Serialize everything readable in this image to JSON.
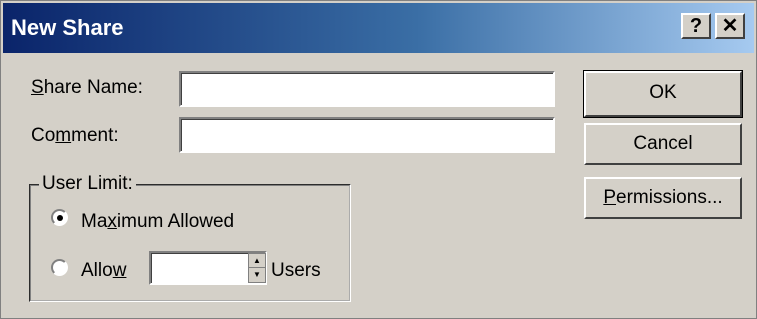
{
  "window": {
    "title": "New Share",
    "help_label": "?",
    "close_label": "✕"
  },
  "form": {
    "share_name_label_prefix": "",
    "share_name_label_accel": "S",
    "share_name_label_rest": "hare Name:",
    "share_name_value": "",
    "comment_label_pre": "Co",
    "comment_label_accel": "m",
    "comment_label_rest": "ment:",
    "comment_value": ""
  },
  "user_limit": {
    "legend": "User Limit:",
    "maximum_label_pre": "Ma",
    "maximum_label_accel": "x",
    "maximum_label_rest": "imum Allowed",
    "maximum_selected": true,
    "allow_label_pre": "Allo",
    "allow_label_accel": "w",
    "allow_label_rest": "",
    "allow_value": "",
    "users_label": "Users"
  },
  "buttons": {
    "ok": "OK",
    "cancel": "Cancel",
    "permissions_accel": "P",
    "permissions_rest": "ermissions..."
  }
}
